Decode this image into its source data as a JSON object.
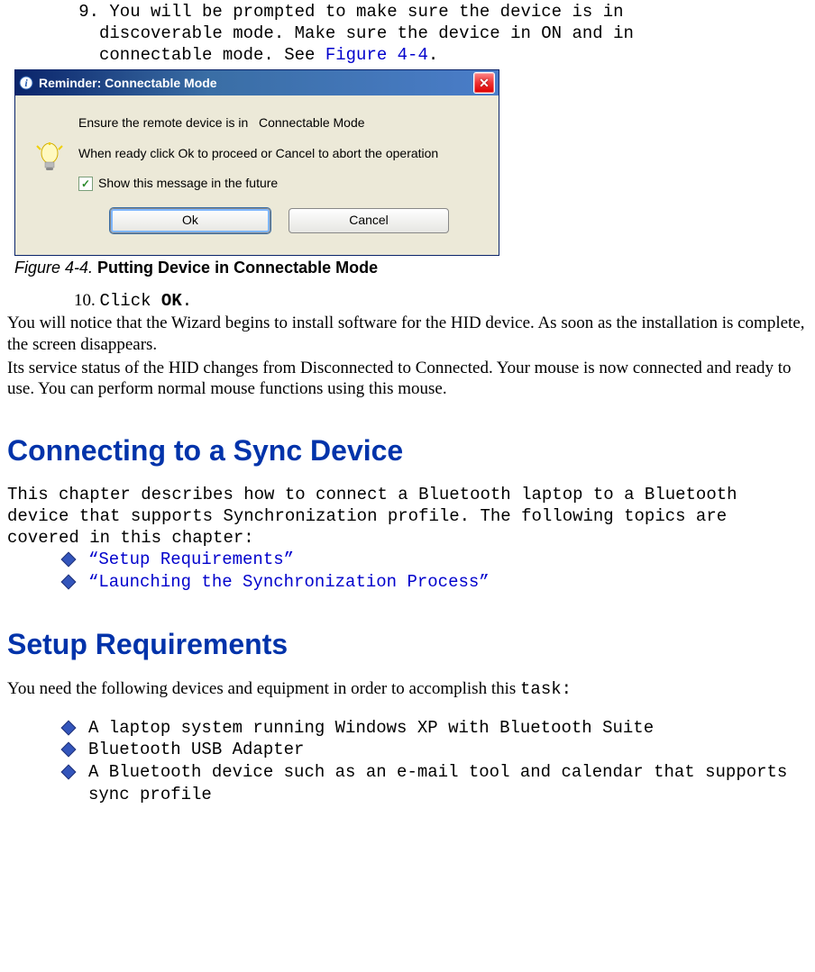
{
  "step9": {
    "number": "9.",
    "line1": "You will be prompted to make sure the device is in",
    "line2": "discoverable mode. Make sure the device in ON and in",
    "line3_a": "connectable mode. See ",
    "line3_link": "Figure 4-4",
    "line3_b": "."
  },
  "dialog": {
    "title": "Reminder:   Connectable Mode",
    "line1_a": "Ensure the remote device is in",
    "line1_b": "Connectable Mode",
    "line2": "When ready click Ok to proceed or Cancel to abort the operation",
    "checkbox_label": "Show this message in the future",
    "ok": "Ok",
    "cancel": "Cancel"
  },
  "caption": {
    "label": "Figure 4-4. ",
    "title": "Putting Device in Connectable Mode"
  },
  "step10": {
    "number": "10.",
    "text_a": "Click ",
    "text_b": "OK",
    "text_c": "."
  },
  "para1": "You will notice that the Wizard begins to install software for the HID device. As soon as the installation is complete, the screen disappears.",
  "para2": "Its service status of the HID changes from Disconnected to Connected. Your mouse is now connected and ready to use. You can perform normal mouse functions using this mouse.",
  "heading1": "Connecting to a Sync Device",
  "intro": "This chapter describes how to connect a Bluetooth laptop to a Bluetooth device that supports Synchronization profile. The following topics are covered in this chapter:",
  "topics": [
    "“Setup Requirements”",
    "“Launching the Synchronization Process”"
  ],
  "heading2": "Setup Requirements",
  "setup_intro_a": "You need the following devices and equipment in order to accomplish this ",
  "setup_intro_b": "task:",
  "setup_items": [
    "A laptop system running Windows XP with Bluetooth Suite",
    "Bluetooth USB Adapter",
    "A Bluetooth device such as an e-mail tool and calendar that supports sync profile"
  ]
}
